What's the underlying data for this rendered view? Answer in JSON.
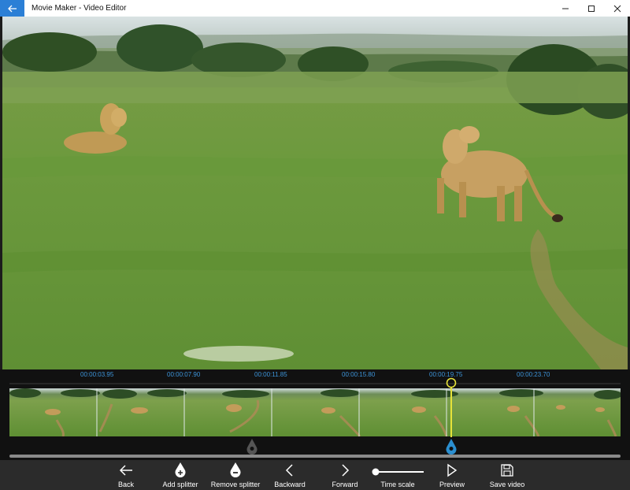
{
  "window": {
    "title": "Movie Maker - Video Editor"
  },
  "timeline": {
    "timestamps": [
      "00:00:03.95",
      "00:00:07.90",
      "00:00:11.85",
      "00:00:15.80",
      "00:00:19.75",
      "00:00:23.70"
    ],
    "playhead_time": "00:00:19.75"
  },
  "toolbar": {
    "back_label": "Back",
    "add_splitter_label": "Add splitter",
    "remove_splitter_label": "Remove splitter",
    "backward_label": "Backward",
    "forward_label": "Forward",
    "time_scale_label": "Time scale",
    "preview_label": "Preview",
    "save_video_label": "Save video"
  },
  "colors": {
    "accent": "#2b7fd6",
    "timestamp": "#3d93d8",
    "playhead": "#e6e23a",
    "splitter_active": "#2b8fd0",
    "splitter_inactive": "#555555"
  }
}
